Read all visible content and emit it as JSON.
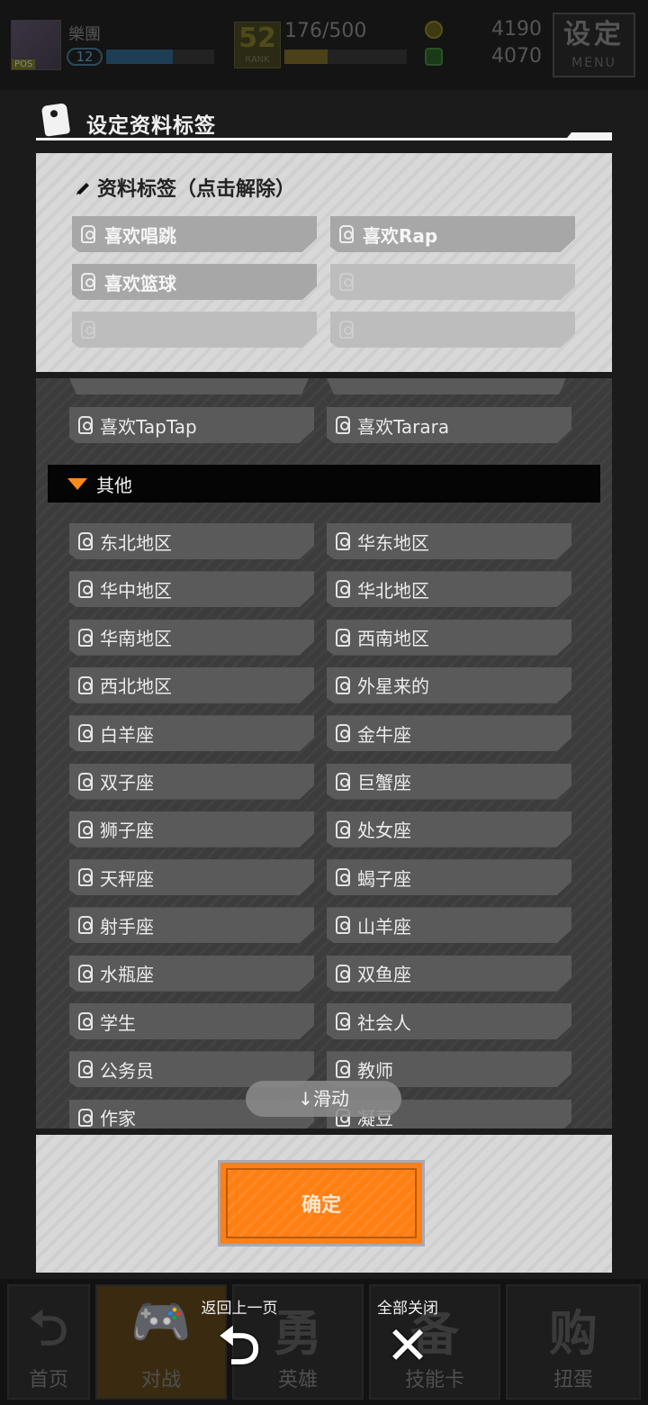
{
  "topbar": {
    "player_name": "樂團",
    "player_level": "12",
    "level_progress": 0.62,
    "rank_number": "52",
    "rank_label": "RANK",
    "exp_text": "176/500",
    "exp_progress": 0.35,
    "coin_gold": "4190",
    "coin_green": "4070",
    "menu_big": "设定",
    "menu_small": "MENU"
  },
  "dialog": {
    "title": "设定资料标签",
    "selected_header": "资料标签（点击解除）",
    "selected_tags": [
      "喜欢唱跳",
      "喜欢Rap",
      "喜欢篮球",
      "",
      "",
      ""
    ],
    "list_top_tags": [
      "喜欢TapTap",
      "喜欢Tarara"
    ],
    "section_label": "其他",
    "other_tags": [
      "东北地区",
      "华东地区",
      "华中地区",
      "华北地区",
      "华南地区",
      "西南地区",
      "西北地区",
      "外星来的",
      "白羊座",
      "金牛座",
      "双子座",
      "巨蟹座",
      "狮子座",
      "处女座",
      "天秤座",
      "蝎子座",
      "射手座",
      "山羊座",
      "水瓶座",
      "双鱼座",
      "学生",
      "社会人",
      "公务员",
      "教师",
      "作家",
      "凝豆"
    ],
    "scroll_hint": "↓滑动",
    "confirm_label": "确定"
  },
  "bottom_nav": {
    "items": [
      {
        "label": "首页",
        "glyph": "⮌"
      },
      {
        "label": "对战",
        "glyph": "🎮"
      },
      {
        "label": "英雄",
        "glyph": "勇"
      },
      {
        "label": "技能卡",
        "glyph": "备"
      },
      {
        "label": "扭蛋",
        "glyph": "购"
      }
    ],
    "back_label": "返回上一页",
    "back_icon": "return-arrow-icon",
    "close_label": "全部关闭",
    "close_icon": "close-x-icon"
  }
}
